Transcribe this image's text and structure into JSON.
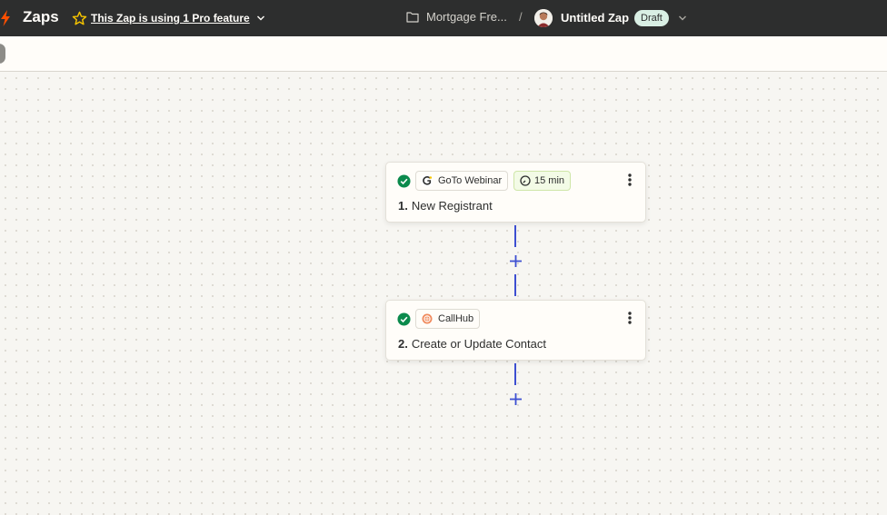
{
  "topbar": {
    "brand": "Zaps",
    "pro_feature": "This Zap is using 1 Pro feature",
    "folder": "Mortgage Fre...",
    "separator": "/",
    "zap_title": "Untitled Zap",
    "status_badge": "Draft"
  },
  "steps": [
    {
      "number": "1.",
      "title": "New Registrant",
      "app": "GoTo Webinar",
      "app_icon": "goto-webinar-logo",
      "schedule": "15 min",
      "status": "complete"
    },
    {
      "number": "2.",
      "title": "Create or Update Contact",
      "app": "CallHub",
      "app_icon": "callhub-logo",
      "status": "complete"
    }
  ],
  "colors": {
    "topbar_bg": "#2d2e2e",
    "brand_orange": "#ff4f00",
    "connector_blue": "#3d4fd1",
    "success_green": "#0b8a4c",
    "draft_badge_bg": "#d9efe4",
    "star_yellow": "#f5c400"
  }
}
